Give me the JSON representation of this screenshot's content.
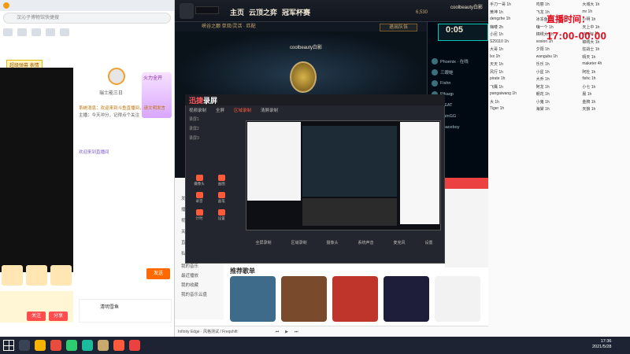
{
  "browser": {
    "address_placeholder": "汉沁子博物馆快捷搜",
    "chat_badge": "超级弹幕 表情",
    "streamer_name": "瑞士能三日",
    "promo_text": "火力全开",
    "chat_messages": [
      "系统消息：欢迎来到斗鱼直播间，请文明发言",
      "主播：今天冲分，记得点个关注",
      "欢迎来到直播间"
    ],
    "send_label": "发送",
    "bottom_btn1": "关注",
    "bottom_btn2": "分享",
    "gift_label": "清明雪鱼"
  },
  "lol": {
    "nav_home": "主页",
    "nav_tft": "云顶之弈",
    "nav_clash": "冠军杯赛",
    "sub_title": "峡谷之巅 单双/灵活 · 匹配",
    "player_name": "coolbeauty白影",
    "confirm_label": "退出队伍",
    "timer": "0:05",
    "profile_name": "coolbeauty白影",
    "currency": "6,530",
    "friends": [
      "Phoenix · 在线",
      "三眼蛙",
      "Fishn",
      "Pikaqp",
      "NiEAT",
      "OuinGG",
      "Apaceboy"
    ]
  },
  "recorder": {
    "logo_prefix": "迅捷",
    "logo_suffix": "录屏",
    "tabs": [
      "视频录制",
      "全屏",
      "区域录制",
      "清屏录制"
    ],
    "left_items": [
      "录屏1",
      "录屏2",
      "录屏3"
    ],
    "tools": [
      "摄像头",
      "画图",
      "录音",
      "画笔",
      "计时",
      "设置"
    ],
    "bottom_items": [
      "全屏录制",
      "区域录制",
      "摄像头",
      "系统声音",
      "麦克风",
      "设置"
    ]
  },
  "music": {
    "side_items": [
      "发现音乐",
      "播客",
      "视频",
      "关注",
      "直播",
      "私人FM",
      "我的音乐",
      "最近播放",
      "我的收藏",
      "我的音乐云盘"
    ],
    "section_title": "推荐歌单",
    "cover_colors": [
      "#3f6b8a",
      "#7a4a2c",
      "#c0352b",
      "#1e1e3a",
      "#f2f2f2"
    ],
    "player_text": "Infinity Edge · 风格测试 / Freqshift"
  },
  "danmaku": {
    "title": "直播时间：",
    "time": "17:00-00:00",
    "entries": [
      "手刀一哥 1h",
      "鸡丽 1h",
      "大城大 1h",
      "黄坤 1h",
      "飞龙 1h",
      "mr 1h",
      "dengzhe 1h",
      "冰冻鱼 1h",
      "小明 1h",
      "嗨喽 2h",
      "嗨一个 1h",
      "天上中 1h",
      "小尼 1h",
      "锦绣大 1h",
      "xiaoke 1h",
      "S29110 1h",
      "sosion 1h",
      "锦绣大 1h",
      "大哥 1h",
      "夕阳 1h",
      "狂战士 1h",
      "lxx 1h",
      "wangubu 1h",
      "晴天 1h",
      "天天 1h",
      "乐乐 1h",
      "maketer 4h",
      "风行 1h",
      "小星 1h",
      "阿杜 1h",
      "pirate 1h",
      "大乔 1h",
      "fishc 1h",
      "飞鹰 1h",
      "阿龙 1h",
      "小七 1h",
      "pangaiwang 1h",
      "朝花 1h",
      "晨 1h",
      "大 1h",
      "小鬼 1h",
      "金牌 1h",
      "Tiger 1h",
      "海棠 1h",
      "天狼 1h"
    ]
  },
  "taskbar": {
    "clock_time": "17:36",
    "clock_date": "2021/5/28"
  }
}
